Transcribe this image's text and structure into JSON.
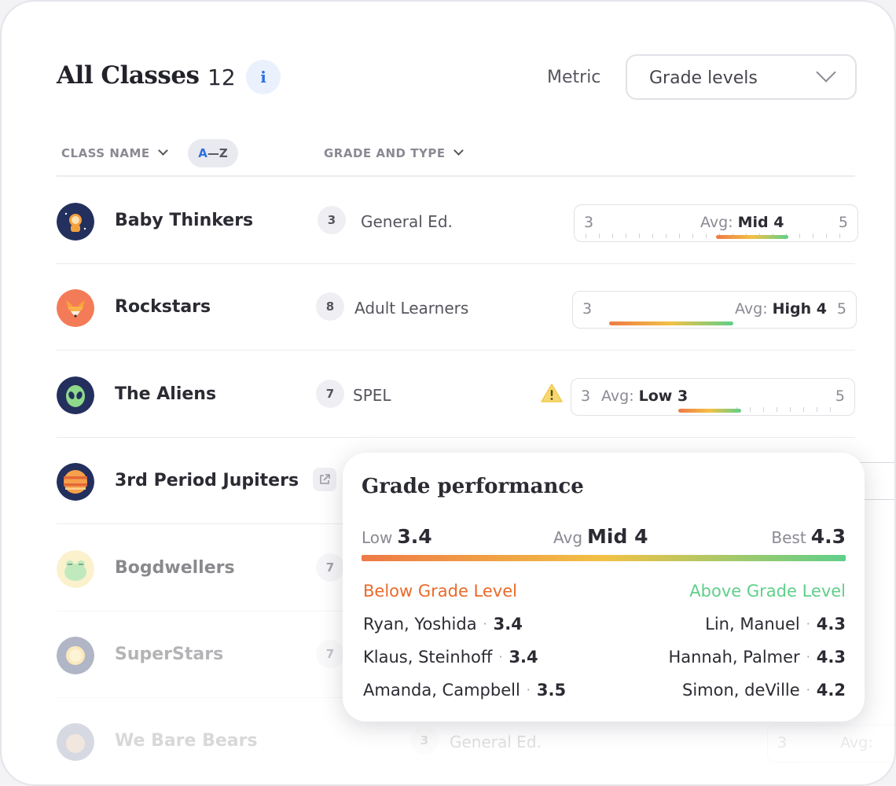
{
  "header": {
    "title": "All Classes",
    "count": "12",
    "info_icon": "info-icon",
    "metric_label": "Metric",
    "metric_value": "Grade levels"
  },
  "columns": {
    "class_name": "CLASS NAME",
    "sort_pill": {
      "a": "A",
      "rest": "—Z"
    },
    "grade_type": "GRADE AND TYPE"
  },
  "rows": [
    {
      "name": "Baby Thinkers",
      "grade": "3",
      "type": "General Ed.",
      "gauge": {
        "low": "3",
        "high": "5",
        "avg_label": "Avg:",
        "avg_value": "Mid 4"
      },
      "avatar": "astronaut-icon"
    },
    {
      "name": "Rockstars",
      "grade": "8",
      "type": "Adult Learners",
      "gauge": {
        "low": "3",
        "high": "5",
        "avg_label": "Avg:",
        "avg_value": "High 4"
      },
      "avatar": "fox-icon"
    },
    {
      "name": "The Aliens",
      "grade": "7",
      "type": "SPEL",
      "gauge": {
        "low": "3",
        "high": "5",
        "avg_label": "Avg:",
        "avg_value": "Low 3"
      },
      "avatar": "alien-icon"
    },
    {
      "name": "3rd Period Jupiters",
      "avatar": "jupiter-icon"
    },
    {
      "name": "Bogdwellers",
      "grade": "7",
      "avatar": "frog-icon"
    },
    {
      "name": "SuperStars",
      "grade": "7",
      "avatar": "sun-icon"
    },
    {
      "name": "We Bare Bears",
      "grade": "3",
      "type": "General Ed.",
      "gauge": {
        "low": "3",
        "avg_label": "Avg:"
      },
      "avatar": "bear-icon"
    }
  ],
  "tooltip": {
    "title": "Grade performance",
    "low_label": "Low",
    "low_value": "3.4",
    "avg_label": "Avg",
    "avg_value": "Mid 4",
    "best_label": "Best",
    "best_value": "4.3",
    "below_heading": "Below Grade Level",
    "above_heading": "Above Grade Level",
    "below": [
      {
        "name": "Ryan, Yoshida",
        "score": "3.4"
      },
      {
        "name": "Klaus, Steinhoff",
        "score": "3.4"
      },
      {
        "name": "Amanda, Campbell",
        "score": "3.5"
      }
    ],
    "above": [
      {
        "name": "Lin, Manuel",
        "score": "4.3"
      },
      {
        "name": "Hannah, Palmer",
        "score": "4.3"
      },
      {
        "name": "Simon, deVille",
        "score": "4.2"
      }
    ],
    "dot": "·"
  },
  "colors": {
    "accent": "#2f6fe0",
    "below": "#ea6a2a",
    "above": "#5fcf8a",
    "warning": "#f5c842"
  }
}
